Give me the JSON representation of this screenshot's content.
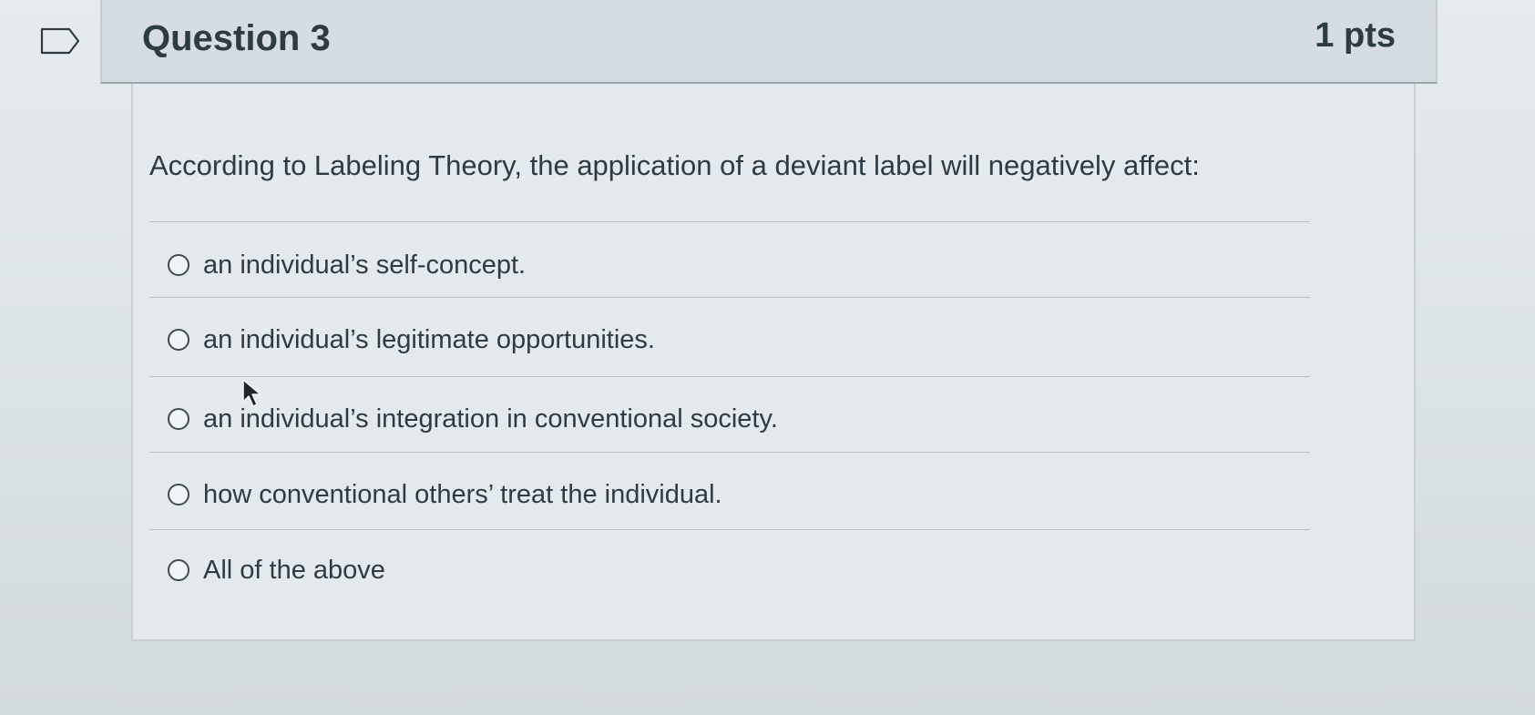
{
  "question": {
    "title": "Question 3",
    "points": "1 pts",
    "text": "According to Labeling Theory, the application of a deviant label will negatively affect:",
    "answers": [
      {
        "label": "an individual’s self-concept.",
        "selected": false
      },
      {
        "label": "an individual’s legitimate opportunities.",
        "selected": false
      },
      {
        "label": "an individual’s integration in conventional society.",
        "selected": false
      },
      {
        "label": "how conventional others’ treat the individual.",
        "selected": false
      },
      {
        "label": "All of the above",
        "selected": false
      }
    ]
  },
  "icons": {
    "flag": "flag-question-icon",
    "cursor": "mouse-pointer-icon"
  },
  "colors": {
    "text": "#2d3b45",
    "header_background": "#d5dde2",
    "body_background": "#e3e9ec",
    "divider": "#b7c1c7"
  }
}
